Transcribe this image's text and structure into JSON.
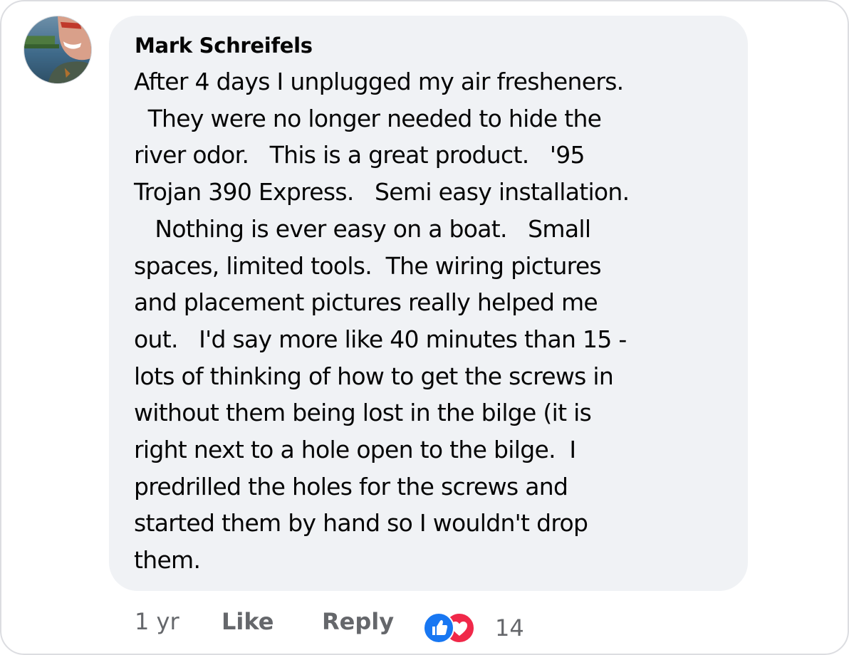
{
  "comment": {
    "author": "Mark Schreifels",
    "lines": [
      "After 4 days I unplugged my air fresheners.",
      "  They were no longer needed to hide the",
      "river odor.   This is a great product.   '95",
      "Trojan 390 Express.   Semi easy installation.",
      "   Nothing is ever easy on a boat.   Small",
      "spaces, limited tools.  The wiring pictures",
      "and placement pictures really helped me",
      "out.   I'd say more like 40 minutes than 15 -",
      "lots of thinking of how to get the screws in",
      "without them being lost in the bilge (it is",
      "right next to a hole open to the bilge.  I",
      "predrilled the holes for the screws and",
      "started them by hand so I wouldn't drop",
      "them."
    ]
  },
  "actions": {
    "timestamp": "1 yr",
    "like_label": "Like",
    "reply_label": "Reply",
    "reaction_count": "14",
    "reaction_icons": [
      "like-icon",
      "love-icon"
    ]
  },
  "colors": {
    "bubble_bg": "#f0f2f5",
    "like_blue": "#1877f2",
    "love_red": "#f02849",
    "meta_gray": "#65676b"
  }
}
